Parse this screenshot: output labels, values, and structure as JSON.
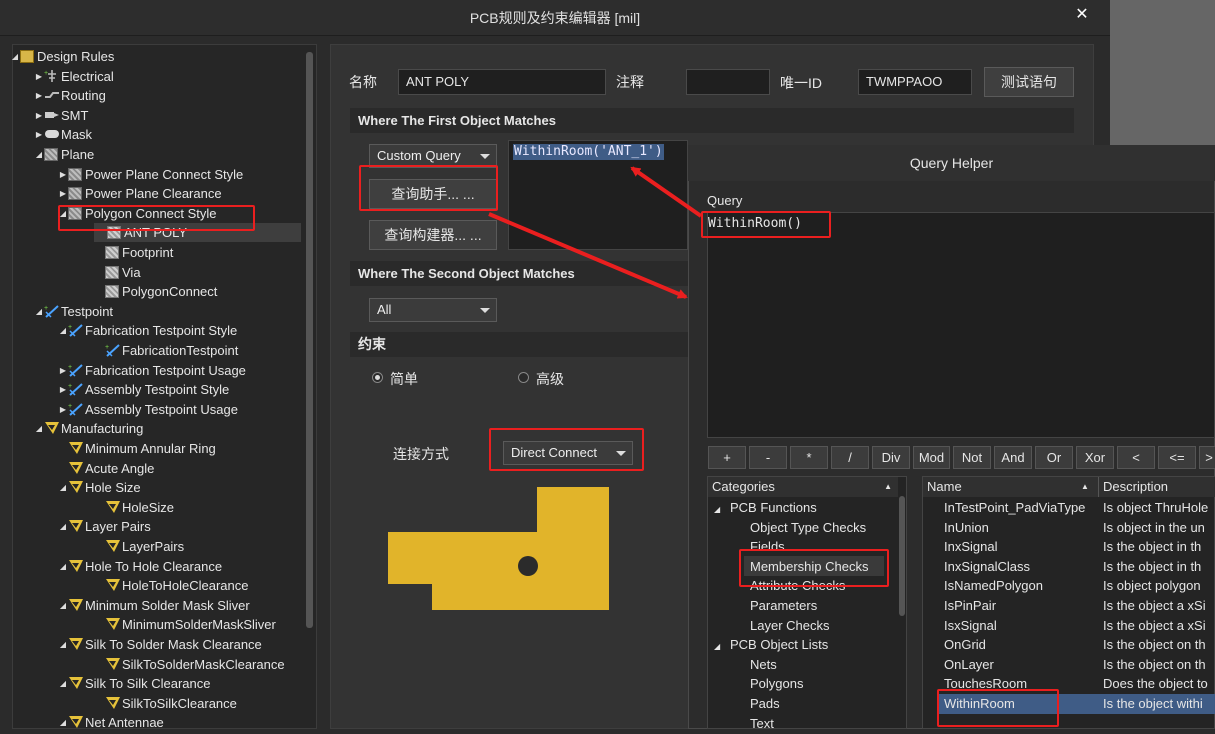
{
  "window": {
    "title": "PCB规则及约束编辑器 [mil]",
    "close_label": "✕"
  },
  "tree": {
    "items": [
      {
        "label": "Design Rules",
        "level": 0,
        "arrow": "◢",
        "icon": "rules-icon"
      },
      {
        "label": "Electrical",
        "level": 1,
        "arrow": "▶",
        "icon": "electrical-icon"
      },
      {
        "label": "Routing",
        "level": 1,
        "arrow": "▶",
        "icon": "routing-icon"
      },
      {
        "label": "SMT",
        "level": 1,
        "arrow": "▶",
        "icon": "smt-icon"
      },
      {
        "label": "Mask",
        "level": 1,
        "arrow": "▶",
        "icon": "mask-icon"
      },
      {
        "label": "Plane",
        "level": 1,
        "arrow": "◢",
        "icon": "plane-icon"
      },
      {
        "label": "Power Plane Connect Style",
        "level": 2,
        "arrow": "▶",
        "icon": "grid-icon"
      },
      {
        "label": "Power Plane Clearance",
        "level": 2,
        "arrow": "▶",
        "icon": "grid-icon"
      },
      {
        "label": "Polygon Connect Style",
        "level": 2,
        "arrow": "◢",
        "icon": "grid-icon"
      },
      {
        "label": "ANT POLY",
        "level": 3,
        "arrow": "",
        "icon": "leaf-icon"
      },
      {
        "label": "Footprint",
        "level": 3,
        "arrow": "",
        "icon": "leaf-icon"
      },
      {
        "label": "Via",
        "level": 3,
        "arrow": "",
        "icon": "leaf-icon"
      },
      {
        "label": "PolygonConnect",
        "level": 3,
        "arrow": "",
        "icon": "leaf-icon"
      },
      {
        "label": "Testpoint",
        "level": 1,
        "arrow": "◢",
        "icon": "testpoint-icon"
      },
      {
        "label": "Fabrication Testpoint Style",
        "level": 2,
        "arrow": "◢",
        "icon": "testpoint-icon"
      },
      {
        "label": "FabricationTestpoint",
        "level": 3,
        "arrow": "",
        "icon": "testpoint-icon"
      },
      {
        "label": "Fabrication Testpoint Usage",
        "level": 2,
        "arrow": "▶",
        "icon": "testpoint-icon"
      },
      {
        "label": "Assembly Testpoint Style",
        "level": 2,
        "arrow": "▶",
        "icon": "testpoint-icon"
      },
      {
        "label": "Assembly Testpoint Usage",
        "level": 2,
        "arrow": "▶",
        "icon": "testpoint-icon"
      },
      {
        "label": "Manufacturing",
        "level": 1,
        "arrow": "◢",
        "icon": "manufacturing-icon"
      },
      {
        "label": "Minimum Annular Ring",
        "level": 2,
        "arrow": "",
        "icon": "manufacturing-icon"
      },
      {
        "label": "Acute Angle",
        "level": 2,
        "arrow": "",
        "icon": "manufacturing-icon"
      },
      {
        "label": "Hole Size",
        "level": 2,
        "arrow": "◢",
        "icon": "manufacturing-icon"
      },
      {
        "label": "HoleSize",
        "level": 3,
        "arrow": "",
        "icon": "manufacturing-icon"
      },
      {
        "label": "Layer Pairs",
        "level": 2,
        "arrow": "◢",
        "icon": "manufacturing-icon"
      },
      {
        "label": "LayerPairs",
        "level": 3,
        "arrow": "",
        "icon": "manufacturing-icon"
      },
      {
        "label": "Hole To Hole Clearance",
        "level": 2,
        "arrow": "◢",
        "icon": "manufacturing-icon"
      },
      {
        "label": "HoleToHoleClearance",
        "level": 3,
        "arrow": "",
        "icon": "manufacturing-icon"
      },
      {
        "label": "Minimum Solder Mask Sliver",
        "level": 2,
        "arrow": "◢",
        "icon": "manufacturing-icon"
      },
      {
        "label": "MinimumSolderMaskSliver",
        "level": 3,
        "arrow": "",
        "icon": "manufacturing-icon"
      },
      {
        "label": "Silk To Solder Mask Clearance",
        "level": 2,
        "arrow": "◢",
        "icon": "manufacturing-icon"
      },
      {
        "label": "SilkToSolderMaskClearance",
        "level": 3,
        "arrow": "",
        "icon": "manufacturing-icon"
      },
      {
        "label": "Silk To Silk Clearance",
        "level": 2,
        "arrow": "◢",
        "icon": "manufacturing-icon"
      },
      {
        "label": "SilkToSilkClearance",
        "level": 3,
        "arrow": "",
        "icon": "manufacturing-icon"
      },
      {
        "label": "Net Antennae",
        "level": 2,
        "arrow": "◢",
        "icon": "manufacturing-icon"
      }
    ],
    "selected_index": 9
  },
  "rule": {
    "name_label": "名称",
    "name_value": "ANT POLY",
    "comment_label": "注释",
    "comment_value": "",
    "uid_label": "唯一ID",
    "uid_value": "TWMPPAOO",
    "test_button": "测试语句"
  },
  "first_match": {
    "header": "Where The First Object Matches",
    "query_type": "Custom Query",
    "query_helper_button": "查询助手... ...",
    "query_builder_button": "查询构建器... ...",
    "query_text": "WithinRoom('ANT_1')"
  },
  "second_match": {
    "header": "Where The Second Object Matches",
    "value": "All"
  },
  "constraints": {
    "header": "约束",
    "simple_label": "简单",
    "advanced_label": "高级",
    "selected_mode": "simple",
    "connect_label": "连接方式",
    "connect_value": "Direct Connect",
    "preview_color": "#e1b42a"
  },
  "query_helper": {
    "title": "Query Helper",
    "query_label": "Query",
    "query_text": "WithinRoom()",
    "operators": [
      "+",
      "-",
      "*",
      "/",
      "Div",
      "Mod",
      "Not",
      "And",
      "Or",
      "Xor",
      "<",
      "<=",
      ">"
    ],
    "categories_header": "Categories",
    "categories": [
      {
        "label": "PCB Functions",
        "level": 0,
        "arrow": "◢"
      },
      {
        "label": "Object Type Checks",
        "level": 1,
        "arrow": ""
      },
      {
        "label": "Fields",
        "level": 1,
        "arrow": ""
      },
      {
        "label": "Membership Checks",
        "level": 1,
        "arrow": ""
      },
      {
        "label": "Attribute Checks",
        "level": 1,
        "arrow": ""
      },
      {
        "label": "Parameters",
        "level": 1,
        "arrow": ""
      },
      {
        "label": "Layer Checks",
        "level": 1,
        "arrow": ""
      },
      {
        "label": "PCB Object Lists",
        "level": 0,
        "arrow": "◢"
      },
      {
        "label": "Nets",
        "level": 1,
        "arrow": ""
      },
      {
        "label": "Polygons",
        "level": 1,
        "arrow": ""
      },
      {
        "label": "Pads",
        "level": 1,
        "arrow": ""
      },
      {
        "label": "Text",
        "level": 1,
        "arrow": ""
      }
    ],
    "selected_category": 3,
    "name_header": "Name",
    "desc_header": "Description",
    "functions": [
      {
        "name": "InTestPoint_PadViaType",
        "desc": "Is object ThruHole"
      },
      {
        "name": "InUnion",
        "desc": "Is object in the un"
      },
      {
        "name": "InxSignal",
        "desc": "Is the object in th"
      },
      {
        "name": "InxSignalClass",
        "desc": "Is the object in th"
      },
      {
        "name": "IsNamedPolygon",
        "desc": "Is object polygon"
      },
      {
        "name": "IsPinPair",
        "desc": "Is the object a xSi"
      },
      {
        "name": "IsxSignal",
        "desc": "Is the object a xSi"
      },
      {
        "name": "OnGrid",
        "desc": "Is the object on th"
      },
      {
        "name": "OnLayer",
        "desc": "Is the object on th"
      },
      {
        "name": "TouchesRoom",
        "desc": "Does the object to"
      },
      {
        "name": "WithinRoom",
        "desc": "Is the object withi"
      }
    ],
    "selected_function": 10
  },
  "colors": {
    "accent_red": "#ea1f1f",
    "selection_blue": "#3f5c86",
    "preview_yellow": "#e1b42a"
  }
}
